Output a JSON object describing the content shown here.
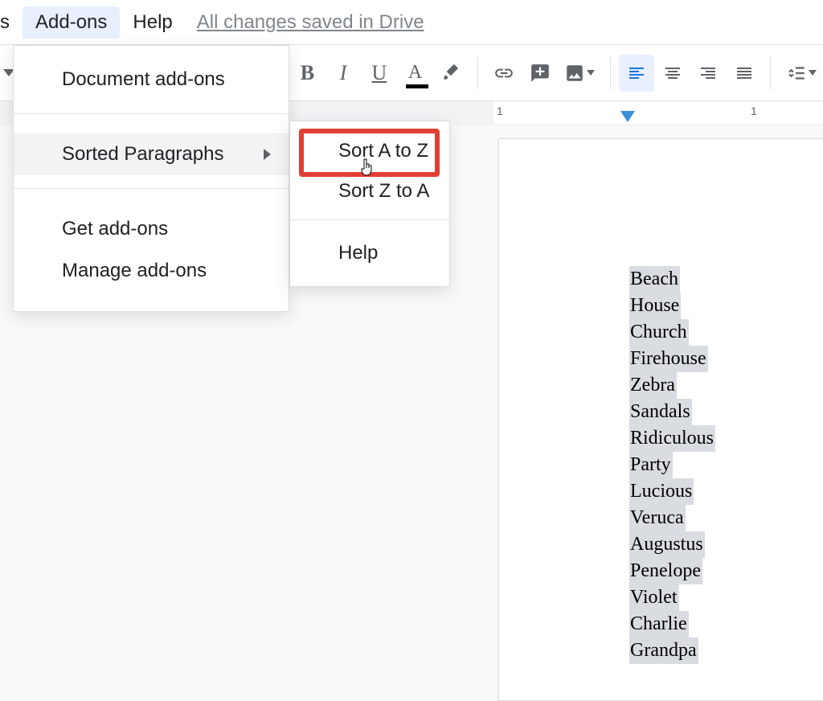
{
  "menubar": {
    "items": [
      "s",
      "Add-ons",
      "Help"
    ],
    "saved_status": "All changes saved in Drive"
  },
  "toolbar": {
    "bold": "B",
    "italic": "I",
    "underline": "U"
  },
  "ruler": {
    "tick_left": "1",
    "tick_right": "1"
  },
  "dropdown": {
    "items": [
      {
        "label": "Document add-ons"
      },
      {
        "label": "Sorted Paragraphs",
        "has_submenu": true
      },
      {
        "label": "Get add-ons"
      },
      {
        "label": "Manage add-ons"
      }
    ]
  },
  "submenu": {
    "items": [
      {
        "label": "Sort A to Z"
      },
      {
        "label": "Sort Z to A"
      },
      {
        "label": "Help"
      }
    ]
  },
  "document": {
    "lines": [
      "Beach",
      "House",
      "Church",
      "Firehouse",
      "Zebra",
      "Sandals",
      "Ridiculous",
      "Party",
      "Lucious",
      "Veruca",
      "Augustus",
      "Penelope",
      "Violet",
      "Charlie",
      "Grandpa"
    ]
  }
}
